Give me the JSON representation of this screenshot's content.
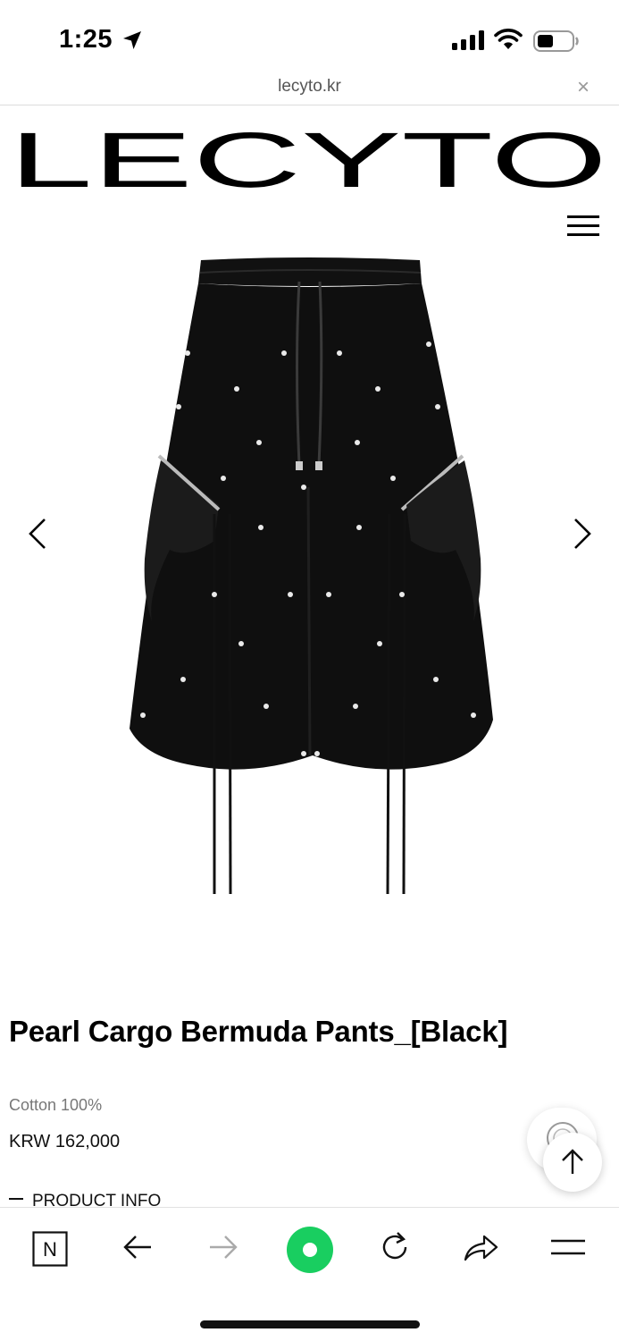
{
  "status_bar": {
    "time": "1:25"
  },
  "browser": {
    "url": "lecyto.kr",
    "close_glyph": "×"
  },
  "site": {
    "logo_text": "LECYTO"
  },
  "product": {
    "title": "Pearl Cargo Bermuda Pants_[Black]",
    "material": "Cotton 100%",
    "price": "KRW 162,000",
    "info_label": "PRODUCT INFO"
  },
  "toolbar": {
    "naver_letter": "N"
  },
  "colors": {
    "accent_green": "#19ce60",
    "text": "#000000",
    "muted": "#777777"
  },
  "icons": [
    "location-arrow-icon",
    "signal-icon",
    "wifi-icon",
    "battery-icon",
    "close-icon",
    "hamburger-icon",
    "chevron-left-icon",
    "chevron-right-icon",
    "chat-icon",
    "arrow-up-icon",
    "naver-icon",
    "back-arrow-icon",
    "forward-arrow-icon",
    "green-dot-icon",
    "reload-icon",
    "share-icon",
    "menu-icon"
  ]
}
